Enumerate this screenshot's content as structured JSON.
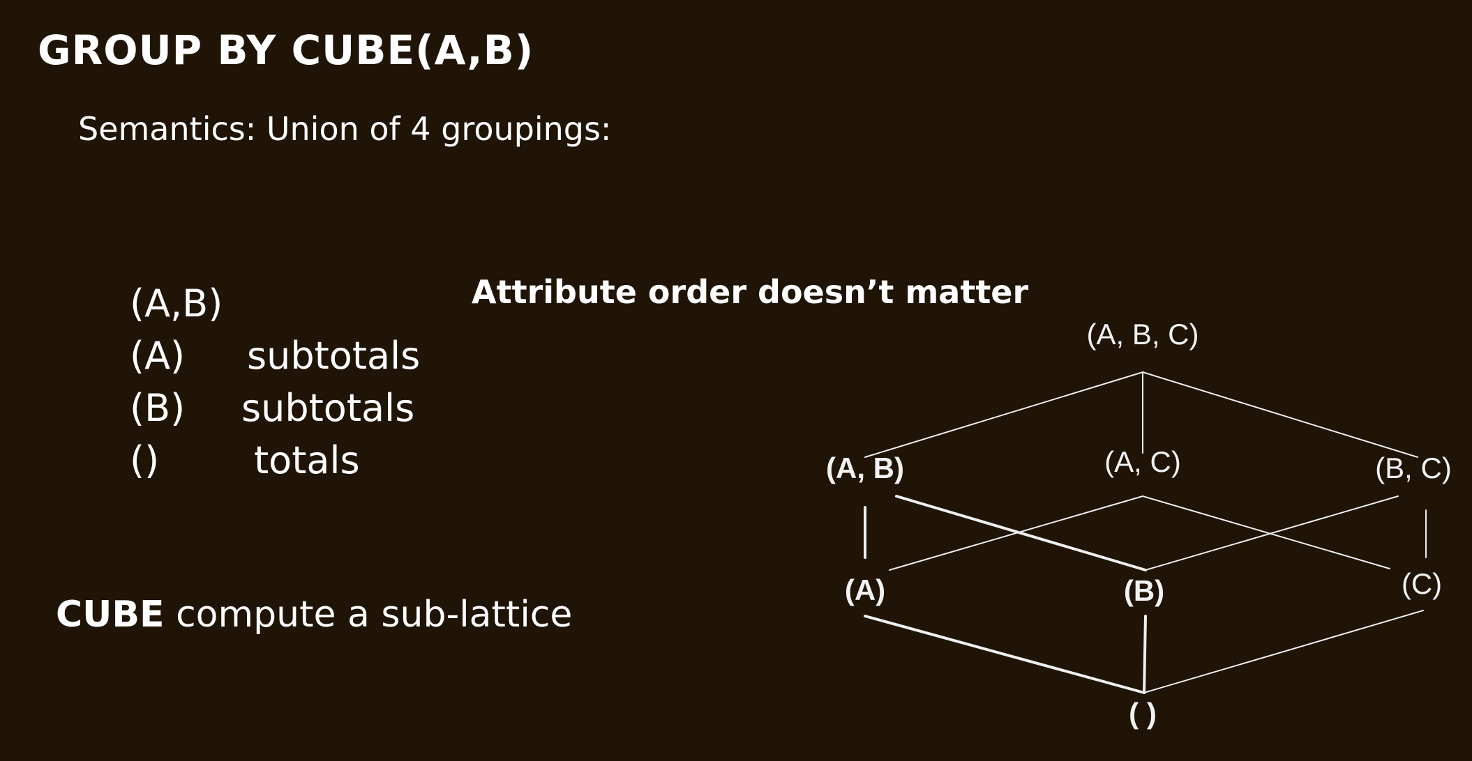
{
  "slide": {
    "title": "GROUP BY CUBE(A,B)",
    "subtitle": "Semantics: Union of 4 groupings:",
    "groupings": [
      {
        "key": "(A,B)",
        "label": ""
      },
      {
        "key": "(A)",
        "label": "subtotals"
      },
      {
        "key": "(B)",
        "label": "subtotals"
      },
      {
        "key": "()",
        "label": "totals"
      }
    ],
    "note": "Attribute order doesn’t matter",
    "cube_keyword": "CUBE",
    "cube_rest": " compute a sub-lattice"
  },
  "lattice": {
    "nodes": {
      "abc": "(A, B, C)",
      "ab": "(A, B)",
      "ac": "(A, C)",
      "bc": "(B, C)",
      "a": "(A)",
      "b": "(B)",
      "c": "(C)",
      "empty": "( )"
    },
    "highlighted": [
      "ab",
      "a",
      "b",
      "empty"
    ],
    "edges": [
      [
        "abc",
        "ab"
      ],
      [
        "abc",
        "ac"
      ],
      [
        "abc",
        "bc"
      ],
      [
        "ab",
        "a"
      ],
      [
        "ab",
        "b"
      ],
      [
        "ac",
        "a"
      ],
      [
        "ac",
        "c"
      ],
      [
        "bc",
        "b"
      ],
      [
        "bc",
        "c"
      ],
      [
        "a",
        "empty"
      ],
      [
        "b",
        "empty"
      ],
      [
        "c",
        "empty"
      ]
    ]
  },
  "colors": {
    "background": "#1f1406",
    "text": "#ffffff"
  }
}
